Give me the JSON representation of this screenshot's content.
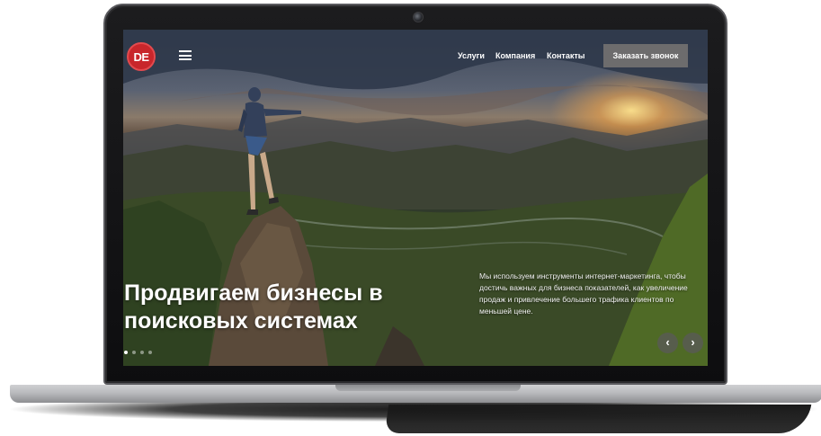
{
  "site": {
    "logo_text": "DE",
    "nav": [
      "Услуги",
      "Компания",
      "Контакты"
    ],
    "cta_label": "Заказать звонок"
  },
  "hero": {
    "headline_line1": "Продвигаем бизнесы в",
    "headline_line2": "поисковых системах",
    "description": "Мы используем инструменты интернет-маркетинга, чтобы достичь важных для бизнеса показателей, как увеличение продаж и привлечение большего трафика клиентов по меньшей цене."
  },
  "slider": {
    "dot_count": 4,
    "active_dot": 1,
    "prev_icon": "‹",
    "next_icon": "›"
  },
  "colors": {
    "logo_red": "#c8262b",
    "cta_bg": "#787673",
    "bezel": "#141416"
  }
}
